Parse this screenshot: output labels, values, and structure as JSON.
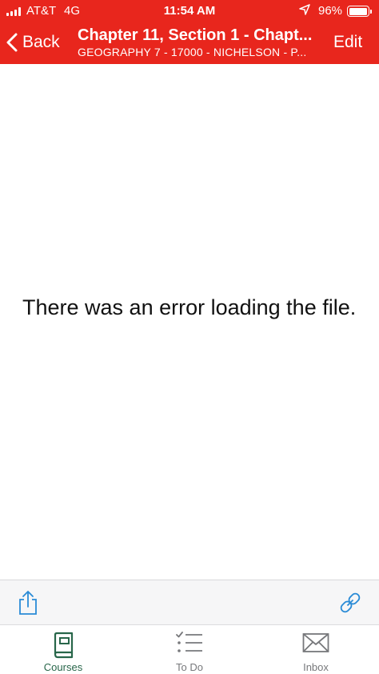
{
  "status_bar": {
    "carrier": "AT&T",
    "network": "4G",
    "time": "11:54 AM",
    "battery_percent": "96%",
    "battery_level": 0.96
  },
  "nav": {
    "back_label": "Back",
    "title": "Chapter 11, Section 1 - Chapt...",
    "subtitle": "GEOGRAPHY 7 - 17000 - NICHELSON - P...",
    "edit_label": "Edit"
  },
  "content": {
    "error_message": "There was an error loading the file."
  },
  "toolbar": {
    "share_icon": "share-icon",
    "link_icon": "link-icon"
  },
  "tabs": [
    {
      "label": "Courses",
      "icon": "book-icon",
      "active": true
    },
    {
      "label": "To Do",
      "icon": "checklist-icon",
      "active": false
    },
    {
      "label": "Inbox",
      "icon": "envelope-icon",
      "active": false
    }
  ],
  "colors": {
    "header_bg": "#e8261d",
    "accent_blue": "#2a8bd6",
    "active_tab": "#28664a",
    "inactive_tab": "#77787b"
  }
}
